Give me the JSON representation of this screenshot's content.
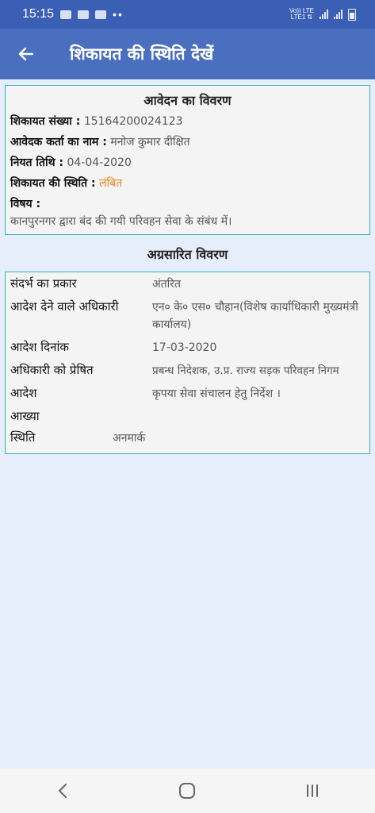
{
  "status_bar": {
    "time": "15:15",
    "network_top": "Vo)) LTE",
    "network_bottom": "LTE1 ⇅"
  },
  "app_bar": {
    "title": "शिकायत की स्थिति देखें"
  },
  "application_details": {
    "heading": "आवेदन का विवरण",
    "complaint_number_label": "शिकायत संख्या :",
    "complaint_number": "15164200024123",
    "applicant_name_label": "आवेदक कर्ता का नाम :",
    "applicant_name": "मनोज कुमार दीक्षित",
    "due_date_label": "नियत तिथि :",
    "due_date": "04-04-2020",
    "status_label": "शिकायत की स्थिति :",
    "status": "लंबित",
    "subject_label": "विषय :",
    "subject": "कानपुरनगर द्वारा बंद की गयी परिवहन सेवा के संबंध में।"
  },
  "forwarded_details": {
    "heading": "अग्रसारित विवरण",
    "rows": [
      {
        "label": "संदर्भ का प्रकार",
        "value": "अंतरित"
      },
      {
        "label": "आदेश देने वाले अधिकारी",
        "value": "एन० के० एस० चौहान(विशेष कार्याधिकारी मुख्यमंत्री कार्यालय)"
      },
      {
        "label": "आदेश दिनांक",
        "value": "17-03-2020"
      },
      {
        "label": "अधिकारी को प्रेषित",
        "value": "प्रबन्ध निदेशक, उ.प्र. राज्य सड़क परिवहन निगम"
      },
      {
        "label": "आदेश",
        "value": "कृपया सेवा संचालन हेतु निर्देश ।"
      },
      {
        "label": "आख्या",
        "value": ""
      },
      {
        "label": "स्थिति",
        "value": "अनमार्क"
      }
    ]
  },
  "colors": {
    "status_bar": "#3a5fb5",
    "app_bar": "#4a6fbe",
    "card_border": "#2fb4c3",
    "pending_status": "#e2871d",
    "link_blue": "#1b2fb4"
  },
  "icons": {
    "back": "arrow-left-icon",
    "nav_back": "chevron-left-icon",
    "nav_home": "home-square-icon",
    "nav_recents": "recents-bars-icon"
  }
}
